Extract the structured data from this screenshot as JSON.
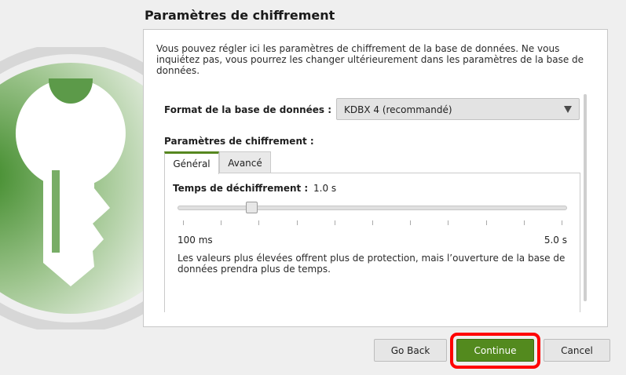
{
  "page": {
    "title": "Paramètres de chiffrement",
    "intro": "Vous pouvez régler ici les paramètres de chiffrement de la base de données. Ne vous inquiétez pas, vous pourrez les changer ultérieurement dans les paramètres de la base de données."
  },
  "format": {
    "label": "Format de la base de données :",
    "selected": "KDBX 4 (recommandé)"
  },
  "encryption": {
    "label": "Paramètres de chiffrement :",
    "tabs": [
      {
        "label": "Général",
        "active": true
      },
      {
        "label": "Avancé",
        "active": false
      }
    ],
    "decryption_time": {
      "label": "Temps de déchiffrement :",
      "value": "1.0 s",
      "level": 0.18,
      "min_label": "100 ms",
      "max_label": "5.0 s"
    },
    "help": "Les valeurs plus élevées offrent plus de protection, mais l’ouverture de la base de données prendra plus de temps."
  },
  "buttons": {
    "back": "Go Back",
    "continue": "Continue",
    "cancel": "Cancel"
  },
  "colors": {
    "accent": "#538a1e",
    "highlight": "#ff0000"
  },
  "icons": {
    "logo": "keepassxc-key-logo",
    "dropdown": "dropdown-arrow-icon"
  }
}
